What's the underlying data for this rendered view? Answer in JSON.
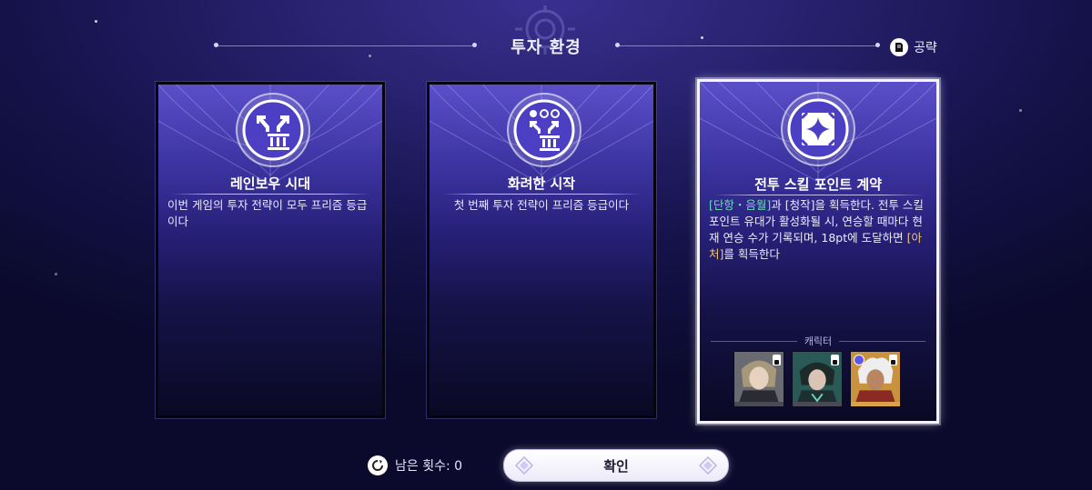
{
  "header": {
    "title": "투자 환경",
    "guide_label": "공략"
  },
  "cards": [
    {
      "title": "레인보우 시대",
      "description": "이번 게임의 투자 전략이 모두 프리즘 등급이다",
      "icon": "branch-tier-three-icon",
      "selected": false
    },
    {
      "title": "화려한 시작",
      "description": "첫 번째 투자 전략이 프리즘 등급이다",
      "icon": "dots-branch-tier-three-icon",
      "selected": false
    },
    {
      "title": "전투 스킬 포인트 계약",
      "description_parts": {
        "a": "[단항・음월]",
        "b": "과 [청작]을 획득한다. 전투 스킬 포인트 유대가 활성화될 시, 연승할 때마다 현재 연승 수가 기록되며, 18pt에 도달하면 ",
        "c": "[아처]",
        "d": "를 획득한다"
      },
      "icon": "sparkle-diamond-icon",
      "selected": true,
      "characters_label": "캐릭터",
      "characters": [
        {
          "name": "character-1",
          "has_clock": false
        },
        {
          "name": "character-2",
          "has_clock": false
        },
        {
          "name": "character-3",
          "has_clock": true
        }
      ]
    }
  ],
  "footer": {
    "retries_label": "남은 횟수: 0",
    "confirm_label": "확인"
  },
  "colors": {
    "highlight_green": "#68e0b5",
    "highlight_gold": "#f6c76d",
    "card_top": "#5a4fc8",
    "background": "#15124a"
  }
}
